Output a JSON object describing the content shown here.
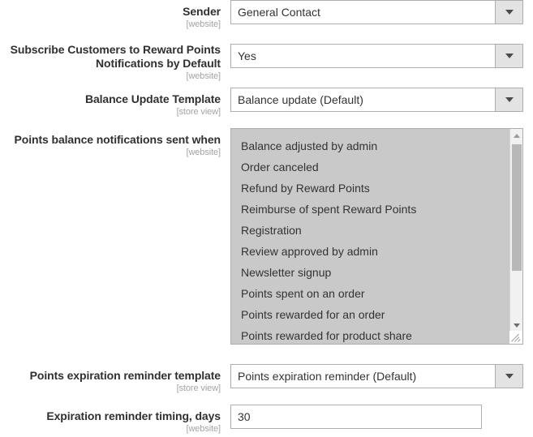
{
  "fields": [
    {
      "label": "Sender",
      "scope": "[website]",
      "type": "select",
      "value": "General Contact",
      "name": "sender"
    },
    {
      "label": "Subscribe Customers to Reward Points Notifications by Default",
      "scope": "[website]",
      "type": "select",
      "value": "Yes",
      "name": "subscribe-customers-to-reward-points-notifications-by-default"
    },
    {
      "label": "Balance Update Template",
      "scope": "[store view]",
      "type": "select",
      "value": "Balance update (Default)",
      "name": "balance-update-template"
    },
    {
      "label": "Points balance notifications sent when",
      "scope": "[website]",
      "type": "multiselect",
      "name": "points-balance-notifications-sent-when",
      "options": [
        "Balance adjusted by admin",
        "Order canceled",
        "Refund by Reward Points",
        "Reimburse of spent Reward Points",
        "Registration",
        "Review approved by admin",
        "Newsletter signup",
        "Points spent on an order",
        "Points rewarded for an order",
        "Points rewarded for product share"
      ]
    },
    {
      "label": "Points expiration reminder template",
      "scope": "[store view]",
      "type": "select",
      "value": "Points expiration reminder (Default)",
      "name": "points-expiration-reminder-template"
    },
    {
      "label": "Expiration reminder timing, days",
      "scope": "[website]",
      "type": "text",
      "value": "30",
      "name": "expiration-reminder-timing-days"
    }
  ],
  "icons": {
    "select_arrow": "chevron-down-icon",
    "scroll_up": "scroll-up-arrow-icon",
    "scroll_down": "scroll-down-arrow-icon",
    "resize_grip": "resize-grip-icon"
  },
  "colors": {
    "label": "#303030",
    "scope": "#a3a3a3",
    "border": "#adadad",
    "select_button_bg": "#e3e3e3",
    "multiselect_bg": "#c9c9c9",
    "scrollbar_track": "#f1f1f1",
    "scrollbar_thumb": "#b8b8b8"
  }
}
